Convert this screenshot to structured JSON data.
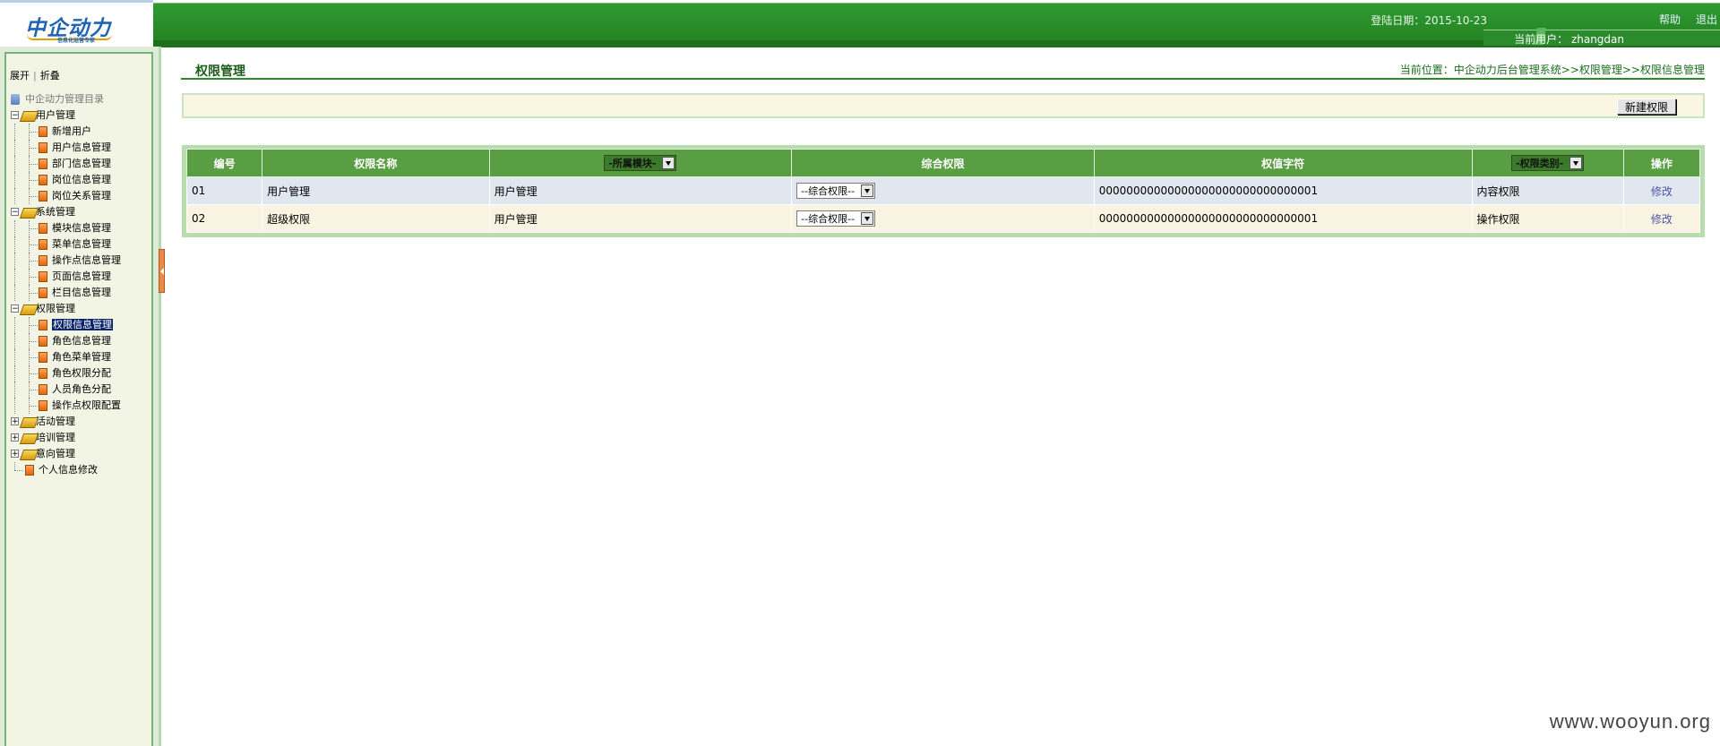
{
  "header": {
    "logo_text": "中企动力",
    "logo_subtext": "信息化运营专家",
    "login_date": "登陆日期：2015-10-23",
    "help": "帮助",
    "logout": "退出",
    "current_user": "当前用户： zhangdan"
  },
  "sidebar": {
    "expand": "展开",
    "collapse": "折叠",
    "root": "中企动力管理目录",
    "groups": [
      {
        "label": "用户管理",
        "items": [
          "新增用户",
          "用户信息管理",
          "部门信息管理",
          "岗位信息管理",
          "岗位关系管理"
        ]
      },
      {
        "label": "系统管理",
        "items": [
          "模块信息管理",
          "菜单信息管理",
          "操作点信息管理",
          "页面信息管理",
          "栏目信息管理"
        ]
      },
      {
        "label": "权限管理",
        "items": [
          "权限信息管理",
          "角色信息管理",
          "角色菜单管理",
          "角色权限分配",
          "人员角色分配",
          "操作点权限配置"
        ]
      },
      {
        "label": "活动管理"
      },
      {
        "label": "培训管理"
      },
      {
        "label": "意向管理"
      }
    ],
    "single": "个人信息修改",
    "selected": "权限信息管理"
  },
  "main": {
    "title": "权限管理",
    "breadcrumb": "当前位置：中企动力后台管理系统>>权限管理>>权限信息管理",
    "new_button": "新建权限",
    "columns": {
      "id": "编号",
      "name": "权限名称",
      "module_filter": "-所属模块-",
      "combined": "综合权限",
      "value": "权值字符",
      "type_filter": "-权限类别-",
      "action": "操作"
    },
    "rows": [
      {
        "id": "01",
        "name": "用户管理",
        "module": "用户管理",
        "combined": "--综合权限--",
        "value": "00000000000000000000000000000001",
        "type": "内容权限",
        "action": "修改"
      },
      {
        "id": "02",
        "name": "超级权限",
        "module": "用户管理",
        "combined": "--综合权限--",
        "value": "00000000000000000000000000000001",
        "type": "操作权限",
        "action": "修改"
      }
    ]
  },
  "watermark": "www.wooyun.org",
  "colors": {
    "header_green": "#2f9a34",
    "table_header": "#5a9e43",
    "row_a": "#e1e7ef",
    "row_b": "#f9f3e2"
  }
}
